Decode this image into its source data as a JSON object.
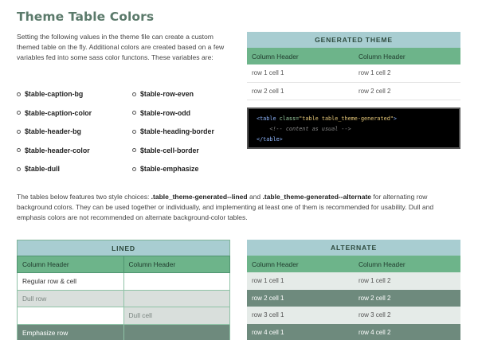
{
  "page": {
    "title": "Theme Table Colors",
    "intro": "Setting the following values in the theme file can create a custom themed table on the fly. Additional colors are created based on a few variables fed into some sass color functons. These variables are:"
  },
  "variables": {
    "left": [
      "$table-caption-bg",
      "$table-caption-color",
      "$table-header-bg",
      "$table-header-color",
      "$table-dull"
    ],
    "right": [
      "$table-row-even",
      "$table-row-odd",
      "$table-heading-border",
      "$table-cell-border",
      "$table-emphasize"
    ]
  },
  "generated_table": {
    "caption": "GENERATED THEME",
    "headers": [
      "Column Header",
      "Column Header"
    ],
    "rows": [
      [
        "row 1 cell 1",
        "row 1 cell 2"
      ],
      [
        "row 2 cell 1",
        "row 2 cell 2"
      ]
    ]
  },
  "code": {
    "open_tag_start": "<table ",
    "attr_name": "class=",
    "attr_value": "\"table table_theme-generated\"",
    "open_tag_end": ">",
    "comment": "<!-- content as usual -->",
    "close_tag": "</table>"
  },
  "paragraph": {
    "part1": "The tables below features two style choices: ",
    "choice1": ".table_theme-generated--lined",
    "part2": " and ",
    "choice2": ".table_theme-generated--alternate",
    "part3": " for alternating row background colors. They can be used together or individually, and implementing at least one of them is recommended for usability. Dull and emphasis colors are not recommended on alternate background-color tables."
  },
  "lined_table": {
    "caption": "LINED",
    "headers": [
      "Column Header",
      "Column Header"
    ],
    "rows": [
      [
        "Regular row & cell",
        ""
      ],
      [
        "Dull row",
        ""
      ],
      [
        "",
        "Dull cell"
      ],
      [
        "Emphasize row",
        ""
      ]
    ]
  },
  "alternate_table": {
    "caption": "ALTERNATE",
    "headers": [
      "Column Header",
      "Column Header"
    ],
    "rows": [
      [
        "row 1 cell 1",
        "row 1 cell 2"
      ],
      [
        "row 2 cell 1",
        "row 2 cell 2"
      ],
      [
        "row 3 cell 1",
        "row 3 cell 2"
      ],
      [
        "row 4 cell 1",
        "row 4 cell 2"
      ]
    ]
  },
  "colors": {
    "title": "#5b7a6b",
    "caption_bg": "#a8cdd1",
    "header_bg": "#6db48a",
    "dull": "#d9dfdc",
    "emphasize": "#6e8a7d"
  }
}
